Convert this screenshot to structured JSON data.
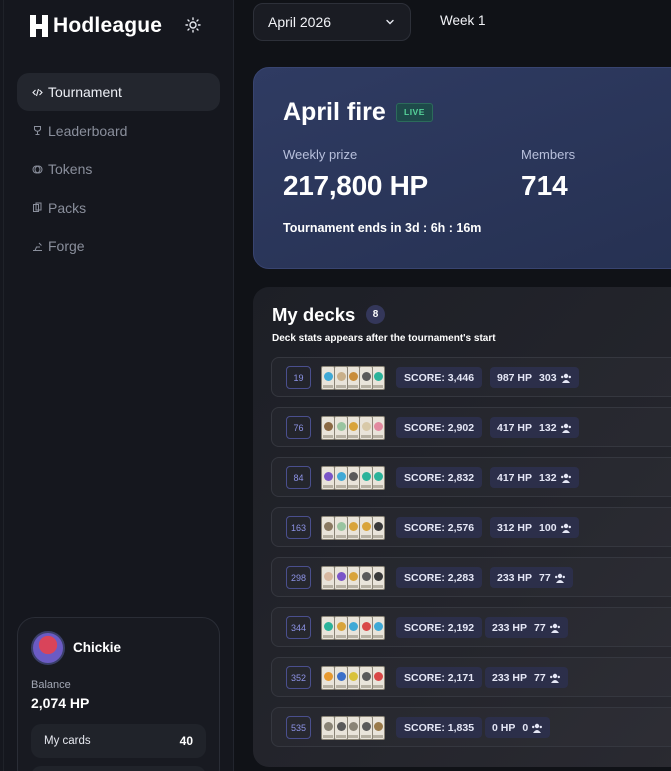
{
  "brand": {
    "name": "Hodleague"
  },
  "nav": [
    {
      "label": "Tournament",
      "icon": "code-icon",
      "active": true
    },
    {
      "label": "Leaderboard",
      "icon": "trophy-icon",
      "active": false
    },
    {
      "label": "Tokens",
      "icon": "coins-icon",
      "active": false
    },
    {
      "label": "Packs",
      "icon": "cards-icon",
      "active": false
    },
    {
      "label": "Forge",
      "icon": "anvil-icon",
      "active": false
    }
  ],
  "user": {
    "name": "Chickie",
    "balance_label": "Balance",
    "balance_value": "2,074 HP",
    "my_cards_label": "My cards",
    "my_cards_count": "40"
  },
  "topbar": {
    "month": "April 2026",
    "week": "Week 1"
  },
  "tournament": {
    "title": "April fire",
    "badge": "LIVE",
    "prize_label": "Weekly prize",
    "prize_value": "217,800 HP",
    "members_label": "Members",
    "members_value": "714",
    "ends_text": "Tournament ends in 3d : 6h : 16m"
  },
  "decks": {
    "title": "My decks",
    "count": "8",
    "subtitle": "Deck stats appears after the tournament's start",
    "rows": [
      {
        "id": "19",
        "score": "SCORE: 3,446",
        "hp": "987 HP",
        "members": "303",
        "card_colors": [
          "#3fa9d6",
          "#c9b08a",
          "#c98d3a",
          "#5a5a5a",
          "#2bb39a"
        ]
      },
      {
        "id": "76",
        "score": "SCORE: 2,902",
        "hp": "417 HP",
        "members": "132",
        "card_colors": [
          "#8b6a44",
          "#9ac4a0",
          "#d9a43a",
          "#d8c9a8",
          "#e28aa0"
        ]
      },
      {
        "id": "84",
        "score": "SCORE: 2,832",
        "hp": "417 HP",
        "members": "132",
        "card_colors": [
          "#7a55c8",
          "#3fa9d6",
          "#5a5a5a",
          "#2bb39a",
          "#2bb39a"
        ]
      },
      {
        "id": "163",
        "score": "SCORE: 2,576",
        "hp": "312 HP",
        "members": "100",
        "card_colors": [
          "#8a7a62",
          "#9ac4a0",
          "#d9a43a",
          "#d9a43a",
          "#3a3a3a"
        ]
      },
      {
        "id": "298",
        "score": "SCORE: 2,283",
        "hp": "233 HP",
        "members": "77",
        "card_colors": [
          "#d8b8a0",
          "#7a55c8",
          "#d9a43a",
          "#5a5a5a",
          "#3a3a3a"
        ]
      },
      {
        "id": "344",
        "score": "SCORE: 2,192",
        "hp": "233 HP",
        "members": "77",
        "card_colors": [
          "#2bb39a",
          "#d9a43a",
          "#3fa9d6",
          "#d94848",
          "#3fa9d6"
        ]
      },
      {
        "id": "352",
        "score": "SCORE: 2,171",
        "hp": "233 HP",
        "members": "77",
        "card_colors": [
          "#e79a30",
          "#3b6fc9",
          "#d9c23a",
          "#5a5a5a",
          "#d94848"
        ]
      },
      {
        "id": "535",
        "score": "SCORE: 1,835",
        "hp": "0 HP",
        "members": "0",
        "card_colors": [
          "#8a8476",
          "#5a5a5a",
          "#8a8476",
          "#5a5a5a",
          "#9a7a4a"
        ]
      }
    ]
  }
}
